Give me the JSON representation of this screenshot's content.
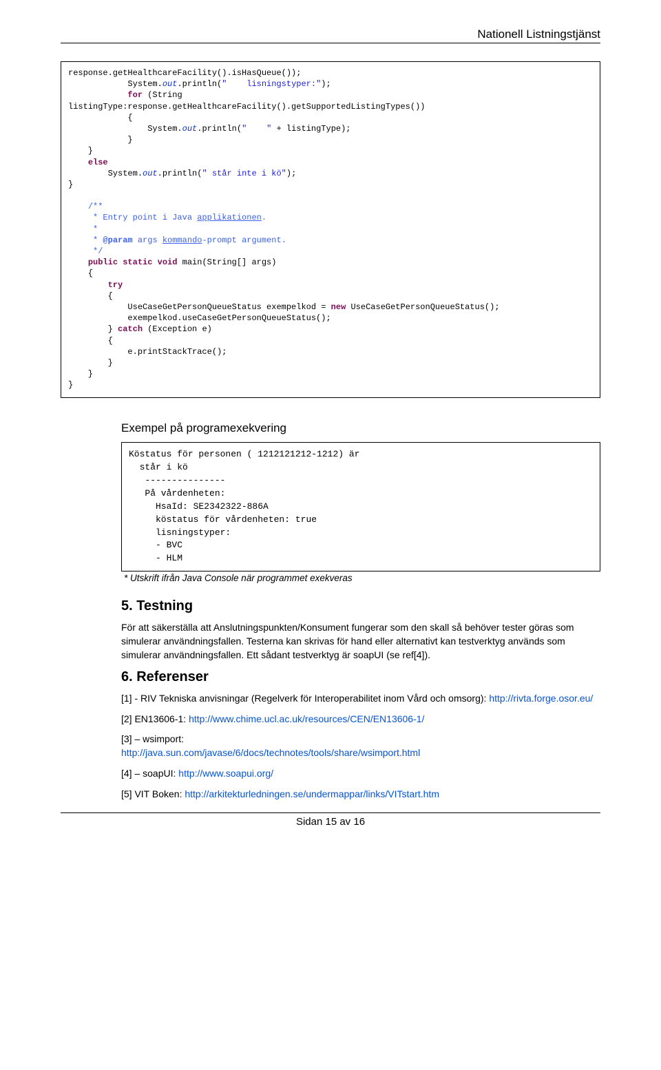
{
  "header": {
    "title": "Nationell Listningstjänst"
  },
  "code_box": {
    "l1a": "response.getHealthcareFacility().isHasQueue());",
    "l2a": "            System.",
    "l2b": "out",
    "l2c": ".println(",
    "l2d": "\"    lisningstyper:\"",
    "l2e": ");",
    "l3a": "            ",
    "l3b": "for",
    "l3c": " (String",
    "l4a": "listingType:response.getHealthcareFacility().getSupportedListingTypes())",
    "l5a": "            {",
    "l6a": "                System.",
    "l6b": "out",
    "l6c": ".println(",
    "l6d": "\"    \"",
    "l6e": " + listingType);",
    "l7a": "            }",
    "l8a": "    }",
    "l9a": "    ",
    "l9b": "else",
    "l10a": "        System.",
    "l10b": "out",
    "l10c": ".println(",
    "l10d": "\" står inte i kö\"",
    "l10e": ");",
    "l11a": "}",
    "l12": "",
    "l13a": "    ",
    "l13b": "/**",
    "l14a": "     * Entry point i Java ",
    "l14b": "applikationen",
    "l14c": ".",
    "l15a": "     *",
    "l16a": "     * ",
    "l16b": "@param",
    "l16c": " args ",
    "l16d": "kommando",
    "l16e": "-",
    "l16f": "prompt argument.",
    "l17a": "     */",
    "l18a": "    ",
    "l18b": "public static void",
    "l18c": " main(String[] args)",
    "l19a": "    {",
    "l20a": "        ",
    "l20b": "try",
    "l21a": "        {",
    "l22a": "            UseCaseGetPersonQueueStatus exempelkod = ",
    "l22b": "new",
    "l22c": " UseCaseGetPersonQueueStatus();",
    "l23a": "            exempelkod.useCaseGetPersonQueueStatus();",
    "l24a": "        } ",
    "l24b": "catch",
    "l24c": " (Exception e)",
    "l25a": "        {",
    "l26a": "            e.printStackTrace();",
    "l27a": "        }",
    "l28a": "    }",
    "l29a": "}"
  },
  "example": {
    "heading": "Exempel på programexekvering",
    "output": "Köstatus för personen ( 1212121212-1212) är\n  står i kö\n   ---------------\n   På vårdenheten:\n     HsaId: SE2342322-886A\n     köstatus för vårdenheten: true\n     lisningstyper:\n     - BVC\n     - HLM",
    "caption": "* Utskrift ifrån Java Console när programmet exekveras"
  },
  "testing": {
    "heading": "5. Testning",
    "para": "För att säkerställa att Anslutningspunkten/Konsument fungerar som den skall så behöver tester göras som simulerar användningsfallen. Testerna kan skrivas för hand eller alternativt kan testverktyg används som simulerar användningsfallen. Ett sådant testverktyg är soapUI (se ref[4])."
  },
  "references": {
    "heading": "6. Referenser",
    "r1_text": " [1] - RIV Tekniska anvisningar (Regelverk för Interoperabilitet inom Vård och omsorg): ",
    "r1_link": "http://rivta.forge.osor.eu/",
    "r2_text": "[2] EN13606-1: ",
    "r2_link": "http://www.chime.ucl.ac.uk/resources/CEN/EN13606-1/",
    "r3_text": "[3] – wsimport:",
    "r3_link": "http://java.sun.com/javase/6/docs/technotes/tools/share/wsimport.html",
    "r4_text": "[4] – soapUI: ",
    "r4_link": "http://www.soapui.org/",
    "r5_text": "[5] VIT Boken: ",
    "r5_link": "http://arkitekturledningen.se/undermappar/links/VITstart.htm"
  },
  "footer": {
    "text": "Sidan 15 av 16"
  }
}
